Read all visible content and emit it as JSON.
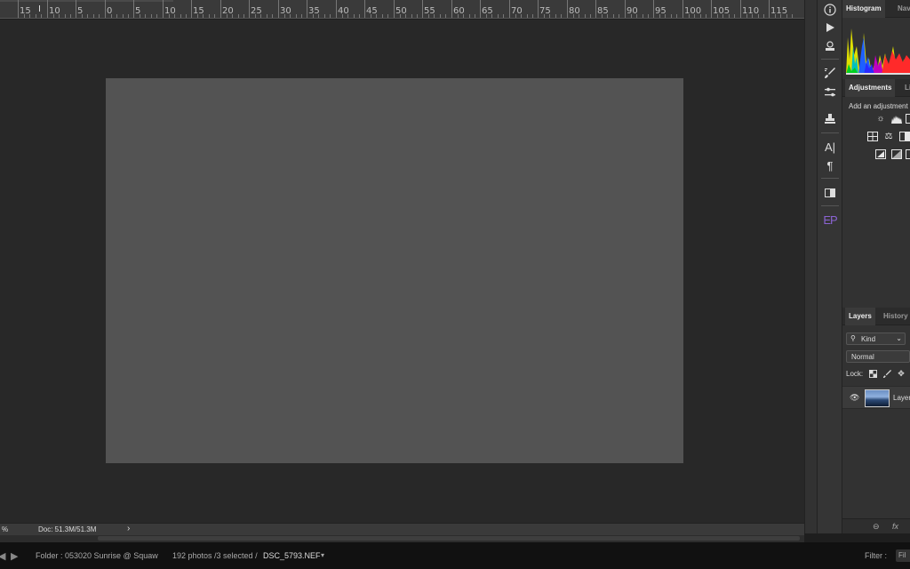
{
  "ruler": {
    "labels": [
      "15",
      "10",
      "5",
      "0",
      "5",
      "10",
      "15",
      "20",
      "25",
      "30",
      "35",
      "40",
      "45",
      "50",
      "55",
      "60",
      "65",
      "70",
      "75",
      "80",
      "85",
      "90",
      "95",
      "100",
      "105",
      "110",
      "115"
    ]
  },
  "status": {
    "zoom": "%",
    "doc_size": "Doc: 51.3M/51.3M",
    "arrow": "›"
  },
  "panels": {
    "histogram_tab": "Histogram",
    "navigator_tab": "Nav",
    "adjustments_tab": "Adjustments",
    "libraries_tab": "Li",
    "adjustments_hint": "Add an adjustment",
    "layers_tab": "Layers",
    "history_tab": "History",
    "kind_filter": "Kind",
    "blend_mode": "Normal",
    "lock_label": "Lock:",
    "layer_name": "Layer"
  },
  "tools": {
    "ep_label": "EP"
  },
  "layers_footer": {
    "link": "⊖",
    "fx": "fx"
  },
  "filmstrip": {
    "folder": "Folder : 053020 Sunrise @ Squaw",
    "selection": "192 photos /3 selected /",
    "filename": "DSC_5793.NEF",
    "filename_arrow": "▾",
    "filter_label": "Filter :",
    "filter_button": "Fil"
  },
  "colors": {
    "canvas": "#535353",
    "workspace": "#282828",
    "ep_accent": "#8a63d2"
  }
}
